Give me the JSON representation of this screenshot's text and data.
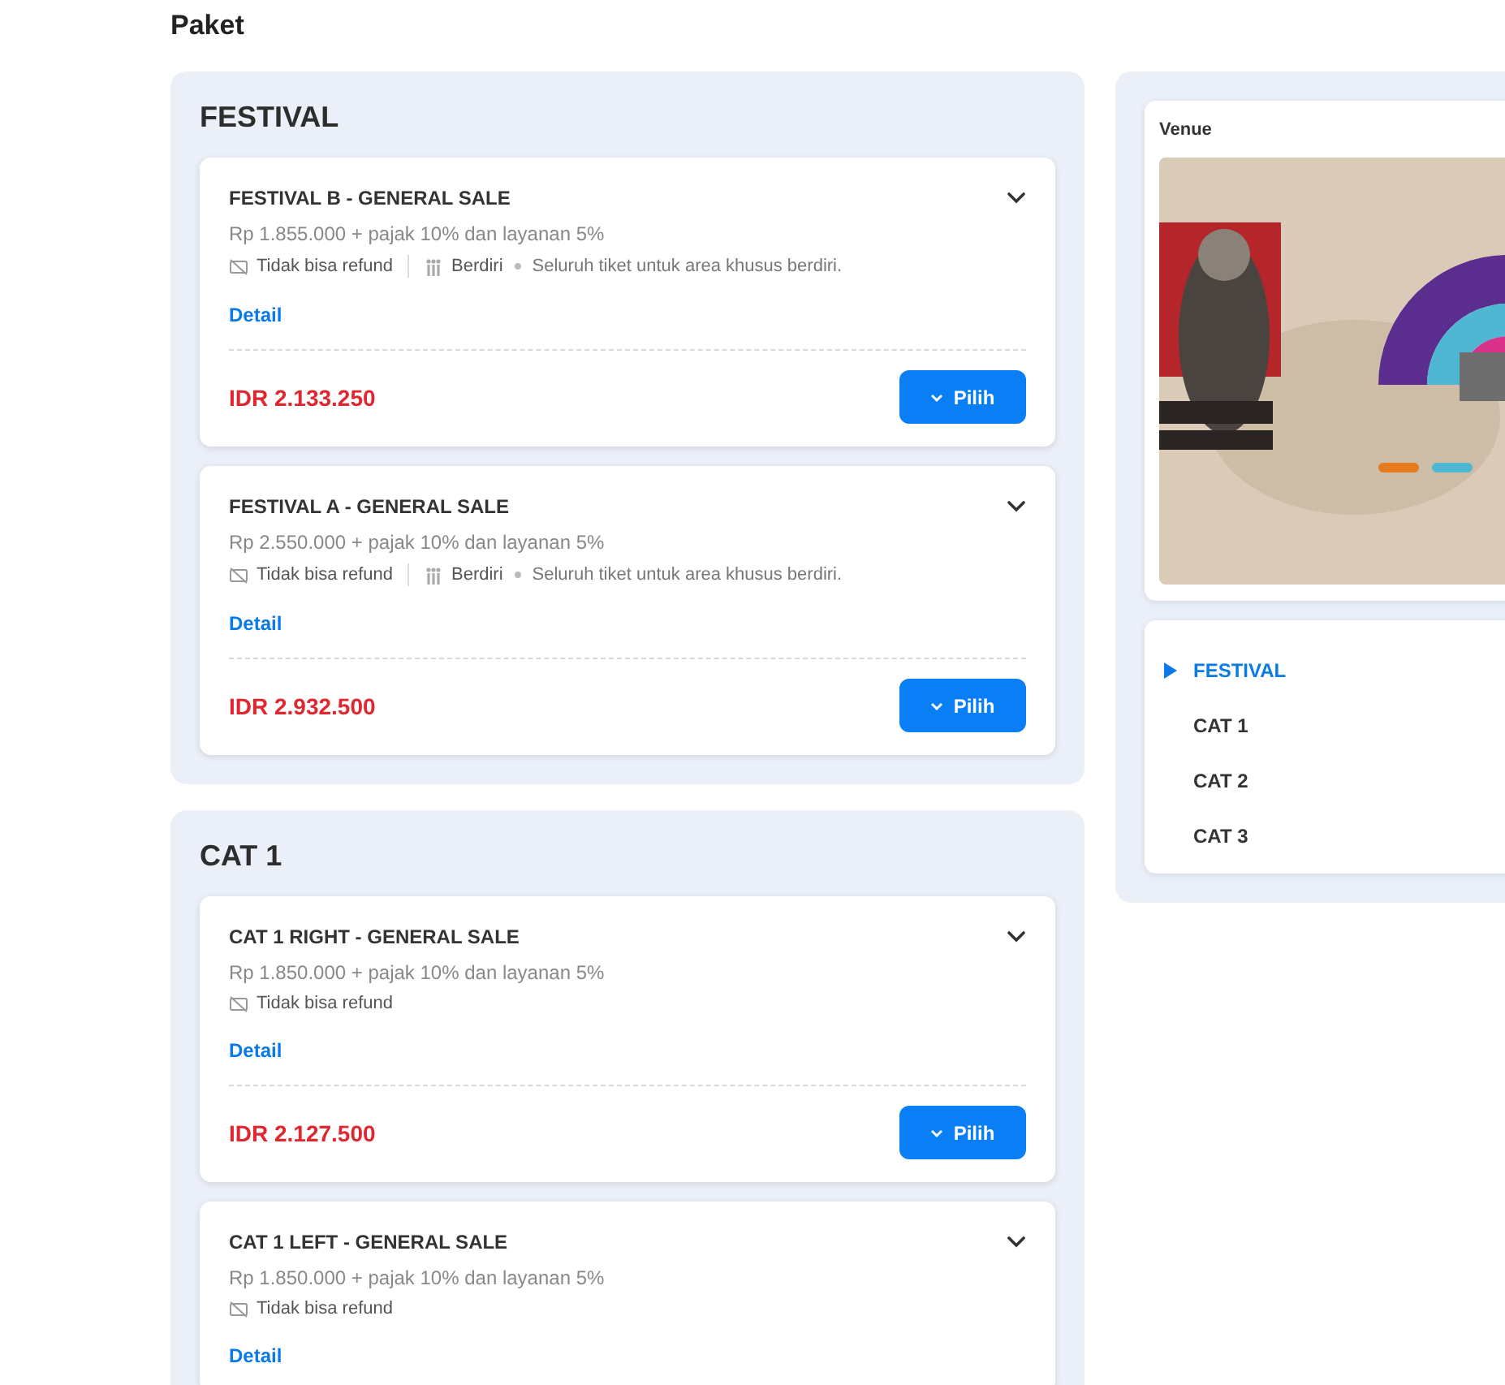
{
  "heading": "Paket",
  "sections": [
    {
      "title": "FESTIVAL",
      "items": [
        {
          "title": "FESTIVAL B - GENERAL SALE",
          "price_line": "Rp 1.855.000 + pajak 10% dan layanan 5%",
          "refund": "Tidak bisa refund",
          "seating": "Berdiri",
          "note": "Seluruh tiket untuk area khusus berdiri.",
          "link": "Detail",
          "total": "IDR 2.133.250",
          "button": "Pilih"
        },
        {
          "title": "FESTIVAL A - GENERAL SALE",
          "price_line": "Rp 2.550.000 + pajak 10% dan layanan 5%",
          "refund": "Tidak bisa refund",
          "seating": "Berdiri",
          "note": "Seluruh tiket untuk area khusus berdiri.",
          "link": "Detail",
          "total": "IDR 2.932.500",
          "button": "Pilih"
        }
      ]
    },
    {
      "title": "CAT 1",
      "items": [
        {
          "title": "CAT 1 RIGHT - GENERAL SALE",
          "price_line": "Rp 1.850.000 + pajak 10% dan layanan 5%",
          "refund": "Tidak bisa refund",
          "link": "Detail",
          "total": "IDR 2.127.500",
          "button": "Pilih"
        },
        {
          "title": "CAT 1 LEFT - GENERAL SALE",
          "price_line": "Rp 1.850.000 + pajak 10% dan layanan 5%",
          "refund": "Tidak bisa refund",
          "link": "Detail"
        }
      ]
    }
  ],
  "venue": {
    "label": "Venue"
  },
  "nav": [
    {
      "label": "FESTIVAL",
      "selected": true
    },
    {
      "label": "CAT 1",
      "selected": false
    },
    {
      "label": "CAT 2",
      "selected": false
    },
    {
      "label": "CAT 3",
      "selected": false
    }
  ]
}
